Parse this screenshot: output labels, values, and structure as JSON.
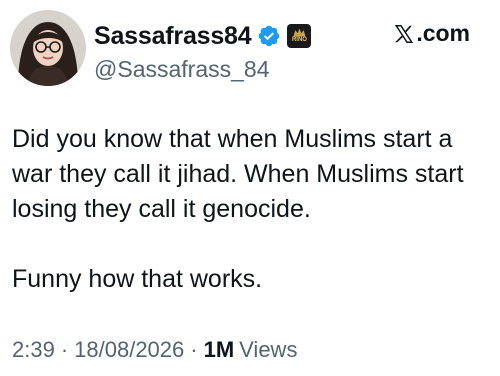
{
  "author": {
    "display_name": "Sassafrass84",
    "handle": "@Sassafrass_84",
    "verified_icon": "verified-badge-icon",
    "affiliate_badge": {
      "icon": "rino-crest-badge-icon",
      "text": "RINO"
    }
  },
  "source": {
    "logo_icon": "x-logo-icon",
    "text": ".com"
  },
  "tweet": {
    "paragraphs": [
      "Did you know that when Muslims start a war they call it jihad. When Muslims start losing they call it genocide.",
      "Funny how that works."
    ]
  },
  "meta": {
    "time": "2:39",
    "date": "18/08/2026",
    "views_count": "1M",
    "views_label": "Views",
    "separator": "·"
  },
  "colors": {
    "text_primary": "#0f1419",
    "text_secondary": "#536471",
    "verified_blue": "#1d9bf0"
  }
}
